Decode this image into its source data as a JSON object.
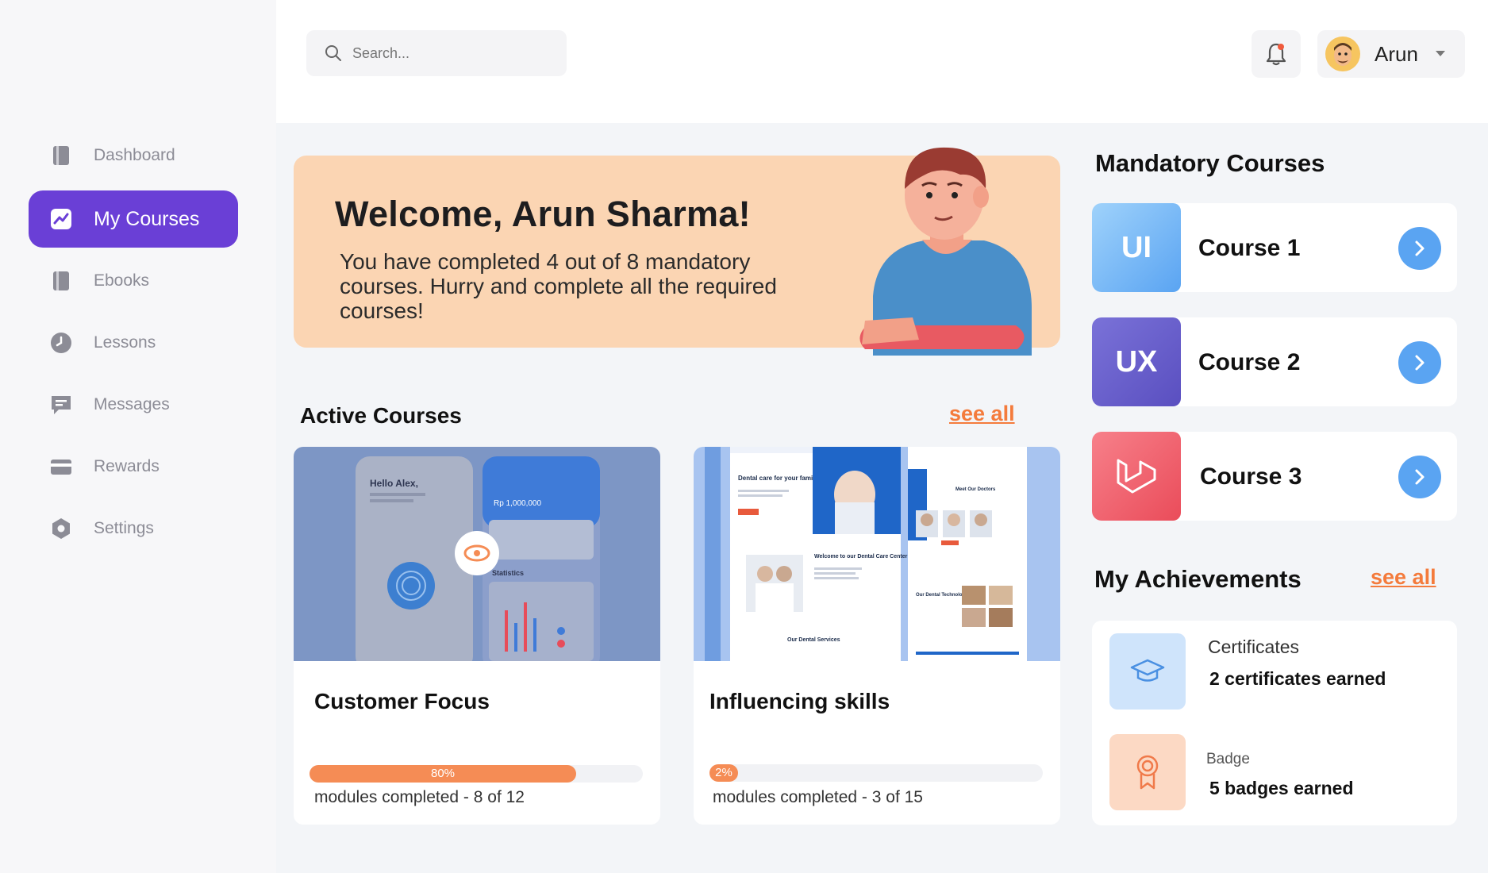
{
  "search": {
    "placeholder": "Search..."
  },
  "user": {
    "name": "Arun"
  },
  "sidebar": {
    "items": [
      {
        "label": "Dashboard",
        "icon": "book-icon",
        "active": false
      },
      {
        "label": "My Courses",
        "icon": "trend-chart-icon",
        "active": true
      },
      {
        "label": "Ebooks",
        "icon": "book-icon",
        "active": false
      },
      {
        "label": "Lessons",
        "icon": "clock-icon",
        "active": false
      },
      {
        "label": "Messages",
        "icon": "message-icon",
        "active": false
      },
      {
        "label": "Rewards",
        "icon": "card-icon",
        "active": false
      },
      {
        "label": "Settings",
        "icon": "gear-icon",
        "active": false
      }
    ]
  },
  "welcome": {
    "title": "Welcome, Arun Sharma!",
    "message": "You have completed 4 out of 8 mandatory courses. Hurry and complete all the required courses!"
  },
  "active_courses": {
    "title": "Active Courses",
    "see_all": "see all",
    "courses": [
      {
        "title": "Customer Focus",
        "progress_label": "80%",
        "progress": 0.8,
        "modules": "modules completed - 8 of 12"
      },
      {
        "title": "Influencing skills",
        "progress_label": "2%",
        "progress": 0.02,
        "modules": "modules completed - 3 of 15"
      }
    ]
  },
  "thumbs": {
    "phone_greeting": "Hello Alex,",
    "phone_balance": "Rp 1,000,000",
    "phone_stats": "Statistics",
    "site_heading": "Dental care for your family",
    "site_welcome": "Welcome to our Dental Care Center",
    "site_services": "Our Dental Services",
    "site_doctors": "Meet Our Doctors",
    "site_tech": "Our Dental Technology"
  },
  "mandatory": {
    "title": "Mandatory Courses",
    "courses": [
      {
        "tile": "UI",
        "label": "Course 1"
      },
      {
        "tile": "UX",
        "label": "Course 2"
      },
      {
        "tile": "",
        "label": "Course 3"
      }
    ]
  },
  "achievements": {
    "title": "My Achievements",
    "see_all": "see all",
    "certificates": {
      "label": "Certificates",
      "value": "2 certificates earned"
    },
    "badges": {
      "label": "Badge",
      "value": "5 badges earned"
    }
  },
  "colors": {
    "accent": "#6a3fd6",
    "hero_bg": "#fbd5b3",
    "progress": "#f58c55",
    "link": "#f47b3c",
    "go_button": "#5aa4f2"
  }
}
